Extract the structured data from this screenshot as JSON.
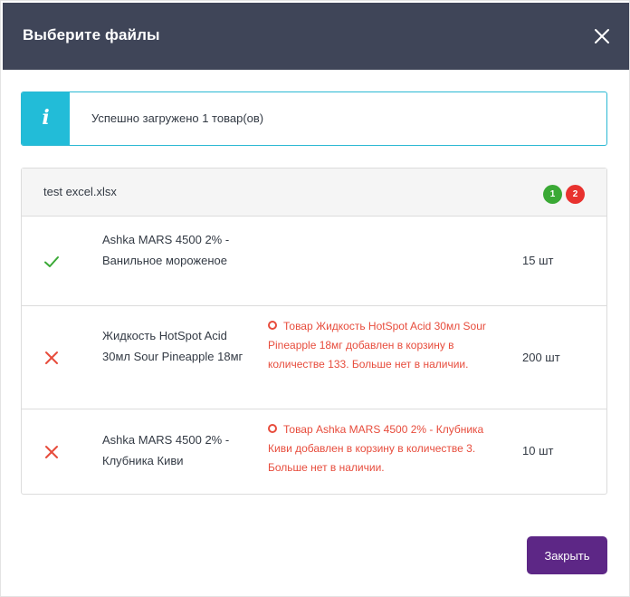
{
  "modal": {
    "title": "Выберите файлы",
    "close_icon": "close-icon"
  },
  "alert": {
    "icon": "info-icon",
    "icon_glyph": "i",
    "message": "Успешно загружено 1 товар(ов)",
    "accent_color": "#22bcd8"
  },
  "file": {
    "name": "test excel.xlsx",
    "success_count": "1",
    "error_count": "2",
    "success_color": "#3aa935",
    "error_color": "#e8322f"
  },
  "rows": [
    {
      "status": "success",
      "status_icon": "check-icon",
      "product": "Ashka MARS 4500 2% - Ванильное мороженое",
      "error": "",
      "quantity": "15 шт"
    },
    {
      "status": "error",
      "status_icon": "cross-icon",
      "product": "Жидкость HotSpot Acid 30мл Sour Pineapple 18мг",
      "error": "Товар Жидкость HotSpot Acid 30мл Sour Pineapple 18мг добавлен в корзину в количестве 133. Больше нет в наличии.",
      "quantity": "200 шт"
    },
    {
      "status": "error",
      "status_icon": "cross-icon",
      "product": "Ashka MARS 4500 2% - Клубника Киви",
      "error": "Товар Ashka MARS 4500 2% - Клубника Киви добавлен в корзину в количестве 3. Больше нет в наличии.",
      "quantity": "10 шт"
    }
  ],
  "footer": {
    "close_label": "Закрыть",
    "button_color": "#5d2786"
  }
}
